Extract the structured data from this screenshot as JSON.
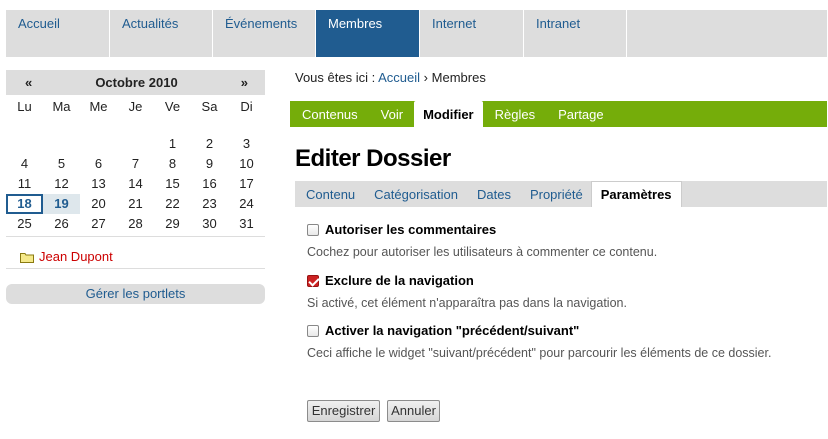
{
  "globalnav": {
    "tabs": [
      {
        "label": "Accueil",
        "active": false
      },
      {
        "label": "Actualités",
        "active": false
      },
      {
        "label": "Événements",
        "active": false
      },
      {
        "label": "Membres",
        "active": true
      },
      {
        "label": "Internet",
        "active": false
      },
      {
        "label": "Intranet",
        "active": false
      }
    ]
  },
  "calendar": {
    "prev": "«",
    "month": "Octobre 2010",
    "next": "»",
    "weekdays": [
      "Lu",
      "Ma",
      "Me",
      "Je",
      "Ve",
      "Sa",
      "Di"
    ],
    "weeks": [
      [
        "",
        "",
        "",
        "",
        "1",
        "2",
        "3"
      ],
      [
        "4",
        "5",
        "6",
        "7",
        "8",
        "9",
        "10"
      ],
      [
        "11",
        "12",
        "13",
        "14",
        "15",
        "16",
        "17"
      ],
      [
        "18",
        "19",
        "20",
        "21",
        "22",
        "23",
        "24"
      ],
      [
        "25",
        "26",
        "27",
        "28",
        "29",
        "30",
        "31"
      ]
    ],
    "today": "18",
    "event_day": "19"
  },
  "user_portlet": {
    "name": "Jean Dupont"
  },
  "manage_portlets": "Gérer les portlets",
  "breadcrumb": {
    "prefix": "Vous êtes ici :",
    "home": "Accueil",
    "separator": "›",
    "current": "Membres"
  },
  "contentviews": [
    {
      "label": "Contenus",
      "active": false
    },
    {
      "label": "Voir",
      "active": false
    },
    {
      "label": "Modifier",
      "active": true
    },
    {
      "label": "Règles",
      "active": false
    },
    {
      "label": "Partage",
      "active": false
    }
  ],
  "title": "Editer Dossier",
  "formtabs": [
    {
      "label": "Contenu",
      "active": false
    },
    {
      "label": "Catégorisation",
      "active": false
    },
    {
      "label": "Dates",
      "active": false
    },
    {
      "label": "Propriété",
      "active": false
    },
    {
      "label": "Paramètres",
      "active": true
    }
  ],
  "fields": {
    "allow_comments": {
      "label": "Autoriser les commentaires",
      "help": "Cochez pour autoriser les utilisateurs à commenter ce contenu.",
      "checked": false
    },
    "exclude_nav": {
      "label": "Exclure de la navigation",
      "help": "Si activé, cet élément n'apparaîtra pas dans la navigation.",
      "checked": true
    },
    "next_prev": {
      "label": "Activer la navigation \"précédent/suivant\"",
      "help": "Ceci affiche le widget \"suivant/précédent\" pour parcourir les éléments de ce dossier.",
      "checked": false
    }
  },
  "buttons": {
    "save": "Enregistrer",
    "cancel": "Annuler"
  },
  "colors": {
    "brand_blue": "#205c90",
    "edit_bar_green": "#75ad0a",
    "tab_gray": "#dddddd"
  }
}
